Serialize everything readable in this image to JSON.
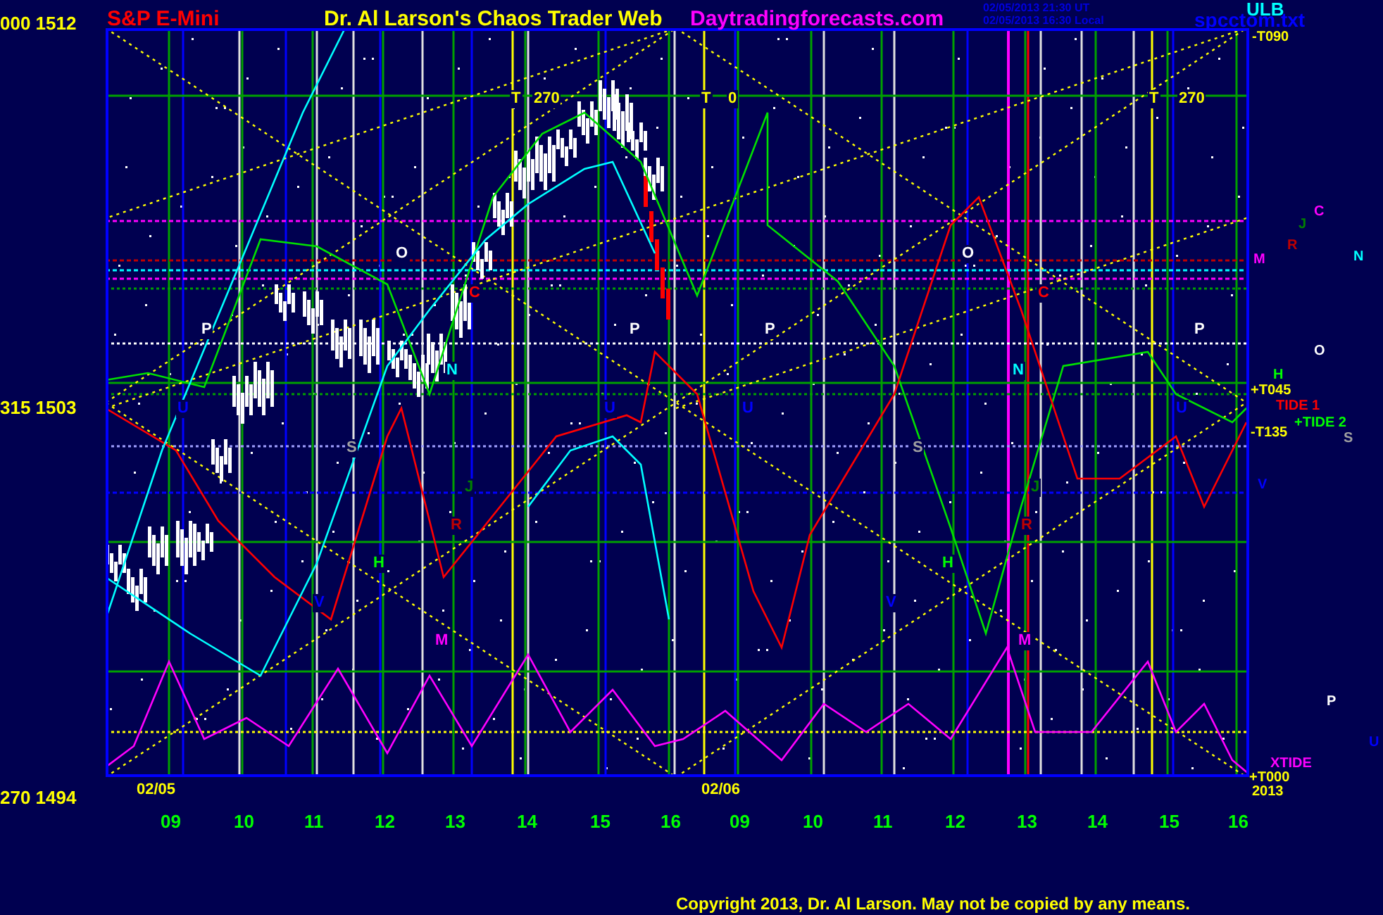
{
  "header": {
    "scale_label": "000 1512",
    "symbol": "S&P E-Mini",
    "title": "Dr. Al Larson's Chaos Trader Web",
    "website": "Daytradingforecasts.com",
    "timestamps": [
      "02/05/2013 21:30 UT",
      "02/05/2013 16:30 Local"
    ],
    "ulb": "ULB",
    "file_name": "spcctom.txt"
  },
  "chart": {
    "y_labels": [
      "315 1503",
      "270 1494"
    ],
    "x_labels": [
      "09",
      "10",
      "11",
      "12",
      "13",
      "14",
      "15",
      "16",
      "09",
      "10",
      "11",
      "12",
      "13",
      "14",
      "15",
      "16"
    ],
    "markers": [
      {
        "text": "T",
        "color": "#ffff00"
      },
      {
        "text": "270",
        "color": "#ffff00"
      },
      {
        "text": "T",
        "color": "#ffff00"
      },
      {
        "text": "0",
        "color": "#ffff00"
      },
      {
        "text": "T",
        "color": "#ffff00"
      },
      {
        "text": "270",
        "color": "#ffff00"
      },
      {
        "text": "O",
        "color": "#ffffff"
      },
      {
        "text": "O",
        "color": "#ffffff"
      },
      {
        "text": "P",
        "color": "#ffffff"
      },
      {
        "text": "P",
        "color": "#ffffff"
      },
      {
        "text": "P",
        "color": "#ffffff"
      },
      {
        "text": "P",
        "color": "#ffffff"
      },
      {
        "text": "C",
        "color": "#ff0000"
      },
      {
        "text": "C",
        "color": "#ff0000"
      },
      {
        "text": "N",
        "color": "#00ffff"
      },
      {
        "text": "N",
        "color": "#00ffff"
      },
      {
        "text": "U",
        "color": "#0000ff"
      },
      {
        "text": "U",
        "color": "#0000ff"
      },
      {
        "text": "U",
        "color": "#0000ff"
      },
      {
        "text": "U",
        "color": "#0000ff"
      },
      {
        "text": "S",
        "color": "#a0a0a0"
      },
      {
        "text": "S",
        "color": "#a0a0a0"
      },
      {
        "text": "J",
        "color": "#008000"
      },
      {
        "text": "J",
        "color": "#008000"
      },
      {
        "text": "R",
        "color": "#c00000"
      },
      {
        "text": "R",
        "color": "#c00000"
      },
      {
        "text": "H",
        "color": "#00ff00"
      },
      {
        "text": "H",
        "color": "#00ff00"
      },
      {
        "text": "V",
        "color": "#0000ff"
      },
      {
        "text": "V",
        "color": "#0000ff"
      },
      {
        "text": "M",
        "color": "#ff00ff"
      },
      {
        "text": "M",
        "color": "#ff00ff"
      },
      {
        "text": "02/05",
        "color": "#ffff00"
      },
      {
        "text": "02/06",
        "color": "#ffff00"
      }
    ],
    "side_labels": [
      {
        "text": "-T090",
        "color": "#ffff00"
      },
      {
        "text": "C",
        "color": "#ff00ff"
      },
      {
        "text": "J",
        "color": "#008000"
      },
      {
        "text": "R",
        "color": "#c00000"
      },
      {
        "text": "M",
        "color": "#ff00ff"
      },
      {
        "text": "N",
        "color": "#00ffff"
      },
      {
        "text": "O",
        "color": "#ffffff"
      },
      {
        "text": "H",
        "color": "#00ff00"
      },
      {
        "text": "+T045",
        "color": "#ffff00"
      },
      {
        "text": "TIDE 1",
        "color": "#ff0000"
      },
      {
        "text": "+TIDE 2",
        "color": "#00ff00"
      },
      {
        "text": "-T135",
        "color": "#ffff00"
      },
      {
        "text": "S",
        "color": "#a0a0a0"
      },
      {
        "text": "V",
        "color": "#0000ff"
      },
      {
        "text": "P",
        "color": "#ffffff"
      },
      {
        "text": "U",
        "color": "#0000ff"
      },
      {
        "text": "XTIDE",
        "color": "#ff00ff"
      },
      {
        "text": "+T000",
        "color": "#ffff00"
      },
      {
        "text": "2013",
        "color": "#ffff00"
      }
    ]
  },
  "copyright": "Copyright 2013, Dr. Al Larson. May not be copied by any means."
}
